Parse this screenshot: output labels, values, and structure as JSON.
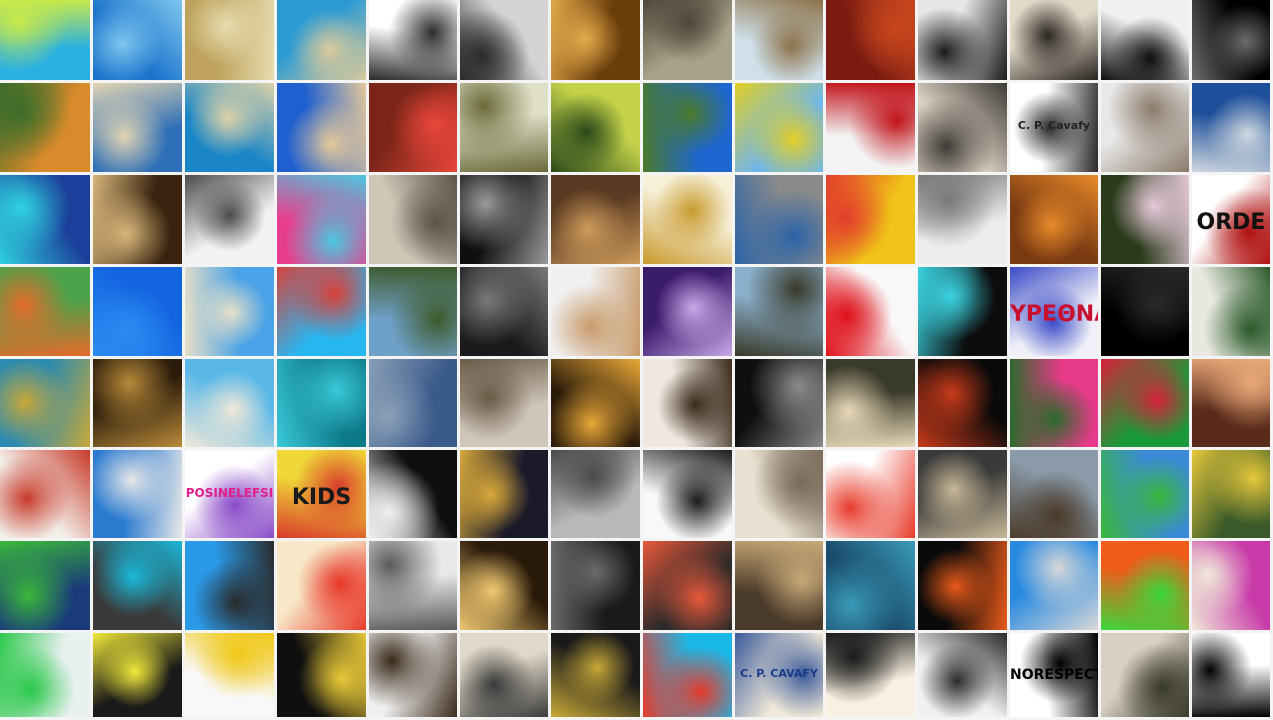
{
  "mosaic": {
    "columns": 14,
    "rows": 8,
    "tiles": [
      {
        "row": 0,
        "col": 0,
        "name": "cartoon-reader-image",
        "c1": "#2ab0e2",
        "c2": "#c7e94a"
      },
      {
        "row": 0,
        "col": 1,
        "name": "sea-horizon-image",
        "c1": "#1c73cc",
        "c2": "#7fc7ef"
      },
      {
        "row": 0,
        "col": 2,
        "name": "woman-reading-image",
        "c1": "#bfa35d",
        "c2": "#e7ddb0"
      },
      {
        "row": 0,
        "col": 3,
        "name": "aerial-beach-image",
        "c1": "#2c9bd3",
        "c2": "#d9c99b"
      },
      {
        "row": 0,
        "col": 4,
        "name": "bicycle-art-image",
        "c1": "#ffffff",
        "c2": "#2b2b2b"
      },
      {
        "row": 0,
        "col": 5,
        "name": "bw-street-image",
        "c1": "#d4d4d4",
        "c2": "#2a2a2a"
      },
      {
        "row": 0,
        "col": 6,
        "name": "golden-sculpture-image",
        "c1": "#6a3d0b",
        "c2": "#e2a94a"
      },
      {
        "row": 0,
        "col": 7,
        "name": "harbor-view-image",
        "c1": "#a9a28b",
        "c2": "#4c4738"
      },
      {
        "row": 0,
        "col": 8,
        "name": "surreal-figure-image",
        "c1": "#cfe0ea",
        "c2": "#8c7248"
      },
      {
        "row": 0,
        "col": 9,
        "name": "red-building-image",
        "c1": "#7a1a12",
        "c2": "#c8471d"
      },
      {
        "row": 0,
        "col": 10,
        "name": "street-walkers-image",
        "c1": "#e7e7e7",
        "c2": "#1a1a1a"
      },
      {
        "row": 0,
        "col": 11,
        "name": "guitar-player-image",
        "c1": "#e0d9c8",
        "c2": "#2a2520"
      },
      {
        "row": 0,
        "col": 12,
        "name": "bw-crowd-image",
        "c1": "#f0f0f0",
        "c2": "#0d0d0d"
      },
      {
        "row": 0,
        "col": 13,
        "name": "dark-portrait-image",
        "c1": "#000000",
        "c2": "#6c6c6c"
      },
      {
        "row": 1,
        "col": 0,
        "name": "vintage-car-image",
        "c1": "#d98a2b",
        "c2": "#3b6d2a"
      },
      {
        "row": 1,
        "col": 1,
        "name": "coastal-town-image",
        "c1": "#2d6fb8",
        "c2": "#e3d4b2"
      },
      {
        "row": 1,
        "col": 2,
        "name": "turquoise-sea-image",
        "c1": "#1a86c7",
        "c2": "#dcd2a8"
      },
      {
        "row": 1,
        "col": 3,
        "name": "beach-bench-image",
        "c1": "#1f5fd0",
        "c2": "#e5c89a"
      },
      {
        "row": 1,
        "col": 4,
        "name": "red-figure-image",
        "c1": "#7a2518",
        "c2": "#e9463a"
      },
      {
        "row": 1,
        "col": 5,
        "name": "lute-player-image",
        "c1": "#e0e0c8",
        "c2": "#6a6a3a"
      },
      {
        "row": 1,
        "col": 6,
        "name": "green-valley-image",
        "c1": "#c4d24a",
        "c2": "#2b4a1a"
      },
      {
        "row": 1,
        "col": 7,
        "name": "field-sky-image",
        "c1": "#1e66d0",
        "c2": "#4c7a2a"
      },
      {
        "row": 1,
        "col": 8,
        "name": "yellow-flowers-image",
        "c1": "#6fb6e8",
        "c2": "#e3cf25"
      },
      {
        "row": 1,
        "col": 9,
        "name": "silhouette-red-image",
        "c1": "#f3f3f3",
        "c2": "#c1141b"
      },
      {
        "row": 1,
        "col": 10,
        "name": "classical-building-image",
        "c1": "#d8cfc0",
        "c2": "#3d3a36"
      },
      {
        "row": 1,
        "col": 11,
        "name": "cavafy-signature-image",
        "c1": "#ffffff",
        "c2": "#2a2a2a",
        "label": "C. P. Cavafy",
        "label_color": "#222222"
      },
      {
        "row": 1,
        "col": 12,
        "name": "two-portraits-image",
        "c1": "#e8e8e8",
        "c2": "#8a7a6a"
      },
      {
        "row": 1,
        "col": 13,
        "name": "volcano-sky-image",
        "c1": "#1d4f9a",
        "c2": "#d0d8e0"
      },
      {
        "row": 2,
        "col": 0,
        "name": "blue-geometric-image",
        "c1": "#1b3f9a",
        "c2": "#2fd1e0"
      },
      {
        "row": 2,
        "col": 1,
        "name": "face-mural-image",
        "c1": "#3a2410",
        "c2": "#d8b67a"
      },
      {
        "row": 2,
        "col": 2,
        "name": "doorway-girl-image",
        "c1": "#f2f2f2",
        "c2": "#4c4c4c"
      },
      {
        "row": 2,
        "col": 3,
        "name": "colorful-doodle-image",
        "c1": "#e83f8c",
        "c2": "#4ac8e0"
      },
      {
        "row": 2,
        "col": 4,
        "name": "hillside-dancers-image",
        "c1": "#cfc6b6",
        "c2": "#5d5448"
      },
      {
        "row": 2,
        "col": 5,
        "name": "poet-portrait-image",
        "c1": "#0f0f0f",
        "c2": "#9a9a9a"
      },
      {
        "row": 2,
        "col": 6,
        "name": "reclining-woman-image",
        "c1": "#5a3a22",
        "c2": "#cc9a5a"
      },
      {
        "row": 2,
        "col": 7,
        "name": "puzzle-piece-image",
        "c1": "#f6f0d8",
        "c2": "#c99a2e"
      },
      {
        "row": 2,
        "col": 8,
        "name": "room-corridor-image",
        "c1": "#8a8a8a",
        "c2": "#2a63a8"
      },
      {
        "row": 2,
        "col": 9,
        "name": "illustrated-boy-image",
        "c1": "#f0c318",
        "c2": "#e23d2b"
      },
      {
        "row": 2,
        "col": 10,
        "name": "sketch-building-image",
        "c1": "#ececec",
        "c2": "#7a7a7a"
      },
      {
        "row": 2,
        "col": 11,
        "name": "cafe-interior-image",
        "c1": "#7a3a12",
        "c2": "#e88a2a"
      },
      {
        "row": 2,
        "col": 12,
        "name": "flower-bouquet-image",
        "c1": "#2a3a1a",
        "c2": "#e4c8d8"
      },
      {
        "row": 2,
        "col": 13,
        "name": "orde-text-image",
        "c1": "#ffffff",
        "c2": "#b01010",
        "label": "ORDE",
        "label_color": "#111111"
      },
      {
        "row": 3,
        "col": 0,
        "name": "child-ball-image",
        "c1": "#4ba24a",
        "c2": "#e56a2a"
      },
      {
        "row": 3,
        "col": 1,
        "name": "blue-sky-plane-image",
        "c1": "#1466e0",
        "c2": "#2a8af2"
      },
      {
        "row": 3,
        "col": 2,
        "name": "cliff-bay-image",
        "c1": "#4aa3e6",
        "c2": "#e8e0c8"
      },
      {
        "row": 3,
        "col": 3,
        "name": "jumping-kids-image",
        "c1": "#27b7f0",
        "c2": "#d8413a"
      },
      {
        "row": 3,
        "col": 4,
        "name": "wheelchair-man-image",
        "c1": "#6fa0c8",
        "c2": "#3d5a2a"
      },
      {
        "row": 3,
        "col": 5,
        "name": "dark-piano-image",
        "c1": "#1a1a1a",
        "c2": "#7a7a7a"
      },
      {
        "row": 3,
        "col": 6,
        "name": "mask-hands-image",
        "c1": "#f0f0f0",
        "c2": "#c89a6a"
      },
      {
        "row": 3,
        "col": 7,
        "name": "purple-graffiti-image",
        "c1": "#3a1a6a",
        "c2": "#c8a8e8"
      },
      {
        "row": 3,
        "col": 8,
        "name": "tank-landscape-image",
        "c1": "#8ab0cc",
        "c2": "#3a3a2a"
      },
      {
        "row": 3,
        "col": 9,
        "name": "red-hoods-image",
        "c1": "#f8f8f8",
        "c2": "#e0101a"
      },
      {
        "row": 3,
        "col": 10,
        "name": "stage-show-image",
        "c1": "#0d0d0d",
        "c2": "#3ad2e0"
      },
      {
        "row": 3,
        "col": 11,
        "name": "festival-poster-image",
        "c1": "#f0f0f8",
        "c2": "#3a4ac8",
        "label": "ΥΡΕΘΝΑ",
        "label_color": "#c8102e"
      },
      {
        "row": 3,
        "col": 12,
        "name": "black-abstract-image",
        "c1": "#000000",
        "c2": "#2a2a2a"
      },
      {
        "row": 3,
        "col": 13,
        "name": "ancient-warriors-image",
        "c1": "#e8e8e0",
        "c2": "#2a5a2a"
      },
      {
        "row": 4,
        "col": 0,
        "name": "world-map-image",
        "c1": "#2a8ab0",
        "c2": "#c8a838"
      },
      {
        "row": 4,
        "col": 1,
        "name": "soundscapes-image",
        "c1": "#2a1a0a",
        "c2": "#b88a3a"
      },
      {
        "row": 4,
        "col": 2,
        "name": "calm-beach-image",
        "c1": "#5ab8e8",
        "c2": "#f0e8d8"
      },
      {
        "row": 4,
        "col": 3,
        "name": "underwater-diver-image",
        "c1": "#0d7a8a",
        "c2": "#3ac8d8"
      },
      {
        "row": 4,
        "col": 4,
        "name": "museum-building-image",
        "c1": "#3a5a8a",
        "c2": "#8aa0b8"
      },
      {
        "row": 4,
        "col": 5,
        "name": "city-aerial-image",
        "c1": "#cfc6b8",
        "c2": "#6a5a48"
      },
      {
        "row": 4,
        "col": 6,
        "name": "lit-corridor-image",
        "c1": "#2a1a0a",
        "c2": "#e8a838"
      },
      {
        "row": 4,
        "col": 7,
        "name": "guitar-closeup-image",
        "c1": "#f0e8e0",
        "c2": "#3a2a1a"
      },
      {
        "row": 4,
        "col": 8,
        "name": "raised-hands-image",
        "c1": "#0f0f0f",
        "c2": "#8a8a8a"
      },
      {
        "row": 4,
        "col": 9,
        "name": "standing-crowd-image",
        "c1": "#3a3a2a",
        "c2": "#e8d8b8"
      },
      {
        "row": 4,
        "col": 10,
        "name": "dome-hall-image",
        "c1": "#0a0a0a",
        "c2": "#c83a1a"
      },
      {
        "row": 4,
        "col": 11,
        "name": "pink-blossom-image",
        "c1": "#e83a8a",
        "c2": "#2a6a2a"
      },
      {
        "row": 4,
        "col": 12,
        "name": "green-abstract-image",
        "c1": "#1a9a3a",
        "c2": "#d8203a"
      },
      {
        "row": 4,
        "col": 13,
        "name": "many-hands-image",
        "c1": "#5a2a1a",
        "c2": "#e8a878"
      },
      {
        "row": 5,
        "col": 0,
        "name": "pinned-map-image",
        "c1": "#f2f0ea",
        "c2": "#c83a2a"
      },
      {
        "row": 5,
        "col": 1,
        "name": "white-cliffs-image",
        "c1": "#2a7ad0",
        "c2": "#e8e8e8"
      },
      {
        "row": 5,
        "col": 2,
        "name": "posinelefsi-poster-image",
        "c1": "#ffffff",
        "c2": "#8a4ac8",
        "label": "POSINELEFSI",
        "label_color": "#e0208a"
      },
      {
        "row": 5,
        "col": 3,
        "name": "kids-graffiti-image",
        "c1": "#f0d838",
        "c2": "#d83a2a",
        "label": "KIDS",
        "label_color": "#1a1a1a"
      },
      {
        "row": 5,
        "col": 4,
        "name": "dancer-frame-image",
        "c1": "#0f0f0f",
        "c2": "#f0f0f0"
      },
      {
        "row": 5,
        "col": 5,
        "name": "stage-set-image",
        "c1": "#1a1a2a",
        "c2": "#d8a83a"
      },
      {
        "row": 5,
        "col": 6,
        "name": "street-bikes-image",
        "c1": "#b8b8b8",
        "c2": "#4a4a4a"
      },
      {
        "row": 5,
        "col": 7,
        "name": "letters-sketch-image",
        "c1": "#f8f8f8",
        "c2": "#1a1a1a"
      },
      {
        "row": 5,
        "col": 8,
        "name": "sketch-drawing-image",
        "c1": "#e8e0d0",
        "c2": "#7a6a5a"
      },
      {
        "row": 5,
        "col": 9,
        "name": "robot-character-image",
        "c1": "#ffffff",
        "c2": "#e83a2a"
      },
      {
        "row": 5,
        "col": 10,
        "name": "street-mural-face-image",
        "c1": "#3a3a3a",
        "c2": "#c8b898"
      },
      {
        "row": 5,
        "col": 11,
        "name": "cloudy-plain-image",
        "c1": "#8a9aa8",
        "c2": "#4a3a2a"
      },
      {
        "row": 5,
        "col": 12,
        "name": "city-skyline-image",
        "c1": "#3a8ad8",
        "c2": "#3ab83a"
      },
      {
        "row": 5,
        "col": 13,
        "name": "wildflower-field-image",
        "c1": "#3a5a2a",
        "c2": "#e8c83a"
      },
      {
        "row": 6,
        "col": 0,
        "name": "globe-art-image",
        "c1": "#1a3a7a",
        "c2": "#3ab83a"
      },
      {
        "row": 6,
        "col": 1,
        "name": "cave-sea-image",
        "c1": "#3a3a3a",
        "c2": "#1ab8d8"
      },
      {
        "row": 6,
        "col": 2,
        "name": "modern-building-image",
        "c1": "#2a9ae8",
        "c2": "#2a2a2a"
      },
      {
        "row": 6,
        "col": 3,
        "name": "toy-ship-image",
        "c1": "#f8e8c8",
        "c2": "#e83a2a"
      },
      {
        "row": 6,
        "col": 4,
        "name": "sitting-woman-image",
        "c1": "#e8e8e8",
        "c2": "#5a5a5a"
      },
      {
        "row": 6,
        "col": 5,
        "name": "piano-keys-glow-image",
        "c1": "#2a1a0a",
        "c2": "#f0c870"
      },
      {
        "row": 6,
        "col": 6,
        "name": "lanyard-people-image",
        "c1": "#1a1a1a",
        "c2": "#6a6a6a"
      },
      {
        "row": 6,
        "col": 7,
        "name": "flower-arrangement-image",
        "c1": "#2a2a2a",
        "c2": "#e8583a"
      },
      {
        "row": 6,
        "col": 8,
        "name": "alley-crowd-image",
        "c1": "#4a3a2a",
        "c2": "#c8a878"
      },
      {
        "row": 6,
        "col": 9,
        "name": "blue-portrait-image",
        "c1": "#1a4a6a",
        "c2": "#3a9ab8"
      },
      {
        "row": 6,
        "col": 10,
        "name": "candles-dark-image",
        "c1": "#0a0a0a",
        "c2": "#e85a1a"
      },
      {
        "row": 6,
        "col": 11,
        "name": "angular-building-image",
        "c1": "#2a8ae0",
        "c2": "#d8d8d8"
      },
      {
        "row": 6,
        "col": 12,
        "name": "orange-illustration-image",
        "c1": "#f05a1a",
        "c2": "#3ad83a"
      },
      {
        "row": 6,
        "col": 13,
        "name": "pink-stripes-image",
        "c1": "#c83aa8",
        "c2": "#f0e8d8"
      },
      {
        "row": 7,
        "col": 0,
        "name": "colored-balls-image",
        "c1": "#e8f0f0",
        "c2": "#2ac84a"
      },
      {
        "row": 7,
        "col": 1,
        "name": "piano-keys-color-image",
        "c1": "#1a1a1a",
        "c2": "#f0e83a"
      },
      {
        "row": 7,
        "col": 2,
        "name": "yellow-ball-image",
        "c1": "#f8f8f8",
        "c2": "#f0c818"
      },
      {
        "row": 7,
        "col": 3,
        "name": "gold-fists-image",
        "c1": "#0f0f0f",
        "c2": "#e8c838"
      },
      {
        "row": 7,
        "col": 4,
        "name": "curtain-figure-image",
        "c1": "#f0f0f0",
        "c2": "#3a2a1a"
      },
      {
        "row": 7,
        "col": 5,
        "name": "classroom-image",
        "c1": "#e0d8c8",
        "c2": "#3a3a3a"
      },
      {
        "row": 7,
        "col": 6,
        "name": "saxophone-player-image",
        "c1": "#1a1a1a",
        "c2": "#c8a838"
      },
      {
        "row": 7,
        "col": 7,
        "name": "cyan-illustration-image",
        "c1": "#1ab8e8",
        "c2": "#e83a2a"
      },
      {
        "row": 7,
        "col": 8,
        "name": "cavafy-book-image",
        "c1": "#f0e8d8",
        "c2": "#3a5a9a",
        "label": "C. P. CAVAFY",
        "label_color": "#1a3a8a"
      },
      {
        "row": 7,
        "col": 9,
        "name": "greek-lettering-image",
        "c1": "#f8f0e0",
        "c2": "#1a1a1a"
      },
      {
        "row": 7,
        "col": 10,
        "name": "bicycle-wall-image",
        "c1": "#f0f0f0",
        "c2": "#2a2a2a"
      },
      {
        "row": 7,
        "col": 11,
        "name": "respect-text-image",
        "c1": "#ffffff",
        "c2": "#000000",
        "label": "NORESPECT",
        "label_color": "#000000"
      },
      {
        "row": 7,
        "col": 12,
        "name": "seated-man-image",
        "c1": "#d8d0c0",
        "c2": "#3a3a2a"
      },
      {
        "row": 7,
        "col": 13,
        "name": "chopsticks-image",
        "c1": "#ffffff",
        "c2": "#000000"
      }
    ]
  }
}
